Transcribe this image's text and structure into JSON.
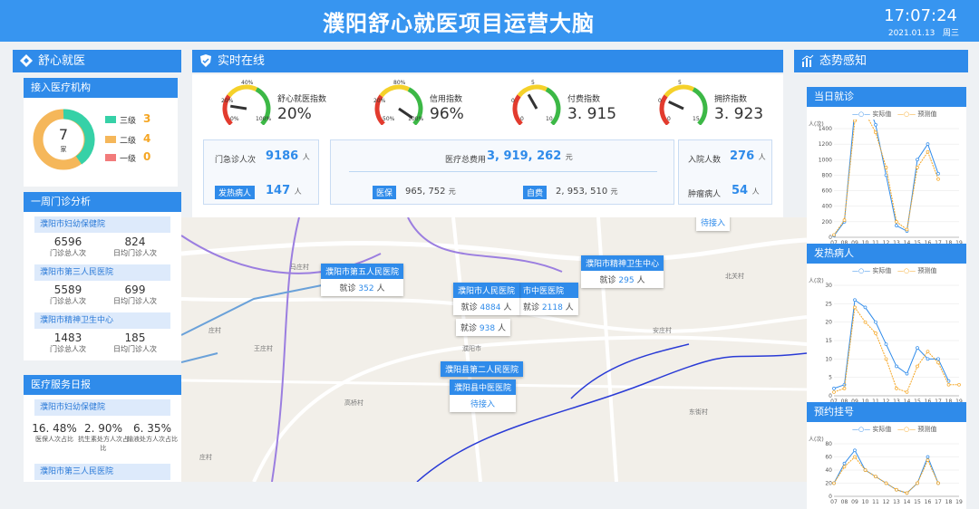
{
  "header": {
    "title": "濮阳舒心就医项目运营大脑",
    "time": "17:07:24",
    "date": "2021.01.13",
    "weekday": "周三"
  },
  "left": {
    "shuxin_title": "舒心就医",
    "institutions_title": "接入医疗机构",
    "donut": {
      "total": "7",
      "unit": "家",
      "levels": [
        {
          "label": "三级",
          "value": "3",
          "color": "#36d1a7"
        },
        {
          "label": "二级",
          "value": "4",
          "color": "#f5b75a"
        },
        {
          "label": "一级",
          "value": "0",
          "color": "#f27b7b"
        }
      ]
    },
    "weekly_title": "一周门诊分析",
    "weekly": [
      {
        "name": "濮阳市妇幼保健院",
        "a": "6596",
        "al": "门诊总人次",
        "b": "824",
        "bl": "日均门诊人次"
      },
      {
        "name": "濮阳市第三人民医院",
        "a": "5589",
        "al": "门诊总人次",
        "b": "699",
        "bl": "日均门诊人次"
      },
      {
        "name": "濮阳市精神卫生中心",
        "a": "1483",
        "al": "门诊总人次",
        "b": "185",
        "bl": "日均门诊人次"
      }
    ],
    "daily_title": "医疗服务日报",
    "daily": {
      "name": "濮阳市妇幼保健院",
      "vals": [
        {
          "v": "16. 48%",
          "l": "医保人次占比"
        },
        {
          "v": "2. 90%",
          "l": "抗生素处方人次占比"
        },
        {
          "v": "6. 35%",
          "l": "输液处方人次占比"
        }
      ],
      "name2": "濮阳市第三人民医院"
    }
  },
  "realtime": {
    "title": "实时在线",
    "gauges": [
      {
        "label": "舒心就医指数",
        "value": "20%",
        "t1": "40%",
        "t2": "20%",
        "t3": "0%",
        "t4": "100%"
      },
      {
        "label": "信用指数",
        "value": "96%",
        "t1": "80%",
        "t2": "20%",
        "t3": "50%",
        "t4": "100%"
      },
      {
        "label": "付费指数",
        "value": "3. 915",
        "t1": "5",
        "t2": "0",
        "t3": "0",
        "t4": "10"
      },
      {
        "label": "拥挤指数",
        "value": "3. 923",
        "t1": "5",
        "t2": "0",
        "t3": "0",
        "t4": "15"
      }
    ],
    "outpatient_label": "门急诊人次",
    "outpatient": "9186",
    "fever_label": "发热病人",
    "fever": "147",
    "total_cost_label": "医疗总费用",
    "total_cost": "3, 919, 262",
    "ins_label": "医保",
    "ins": "965, 752",
    "self_label": "自费",
    "self": "2, 953, 510",
    "admit_label": "入院人数",
    "admit": "276",
    "tumor_label": "肿瘤病人",
    "tumor": "54",
    "unit_person": "人",
    "unit_yuan": "元"
  },
  "map": {
    "popups": [
      {
        "name": "濮阳市第五人民医院",
        "text": "就诊",
        "val": "352",
        "unit": "人"
      },
      {
        "name": "濮阳市精神卫生中心",
        "text": "就诊",
        "val": "295",
        "unit": "人"
      },
      {
        "name": "濮阳市人民医院",
        "text": "就诊",
        "val": "4884",
        "unit": "人"
      },
      {
        "name": "市中医医院",
        "text": "就诊",
        "val": "2118",
        "unit": "人"
      },
      {
        "name": "",
        "text": "就诊",
        "val": "938",
        "unit": "人"
      },
      {
        "name": "濮阳县第二人民医院",
        "text": "",
        "val": "",
        "unit": ""
      },
      {
        "name": "濮阳县中医医院",
        "text": "待接入",
        "val": "",
        "unit": ""
      }
    ],
    "waiting": "待接入",
    "places": [
      "濮阳市",
      "马庄村",
      "庄村",
      "高桥村",
      "王庄村",
      "东街村",
      "安庄村",
      "北关村",
      "庄村"
    ]
  },
  "right": {
    "title": "态势感知",
    "legend_actual": "实际值",
    "legend_pred": "预测值",
    "charts": [
      {
        "title": "当日就诊"
      },
      {
        "title": "发热病人"
      },
      {
        "title": "预约挂号"
      }
    ]
  },
  "chart_data": [
    {
      "type": "line",
      "title": "当日就诊",
      "ylabel": "人(次)",
      "categories": [
        "07",
        "08",
        "09",
        "10",
        "11",
        "12",
        "13",
        "14",
        "15",
        "16",
        "17",
        "18",
        "19"
      ],
      "ylim": [
        0,
        1400
      ],
      "yticks": [
        0,
        200,
        400,
        600,
        800,
        1000,
        1200,
        1400
      ],
      "series": [
        {
          "name": "实际值",
          "values": [
            20,
            200,
            1650,
            1800,
            1450,
            800,
            150,
            80,
            1000,
            1200,
            820,
            null,
            null
          ]
        },
        {
          "name": "预测值",
          "values": [
            30,
            220,
            1500,
            1600,
            1350,
            900,
            200,
            100,
            900,
            1100,
            750,
            null,
            null
          ]
        }
      ]
    },
    {
      "type": "line",
      "title": "发热病人",
      "ylabel": "人(次)",
      "categories": [
        "07",
        "08",
        "09",
        "10",
        "11",
        "12",
        "13",
        "14",
        "15",
        "16",
        "17",
        "18",
        "19"
      ],
      "ylim": [
        0,
        30
      ],
      "yticks": [
        0,
        5,
        10,
        15,
        20,
        25,
        30
      ],
      "series": [
        {
          "name": "实际值",
          "values": [
            2,
            3,
            26,
            24,
            20,
            14,
            8,
            6,
            13,
            10,
            10,
            4,
            null
          ]
        },
        {
          "name": "预测值",
          "values": [
            1,
            2,
            24,
            20,
            17,
            10,
            2,
            1,
            8,
            12,
            9,
            3,
            3
          ]
        }
      ]
    },
    {
      "type": "line",
      "title": "预约挂号",
      "ylabel": "人(次)",
      "categories": [
        "07",
        "08",
        "09",
        "10",
        "11",
        "12",
        "13",
        "14",
        "15",
        "16",
        "17",
        "18",
        "19"
      ],
      "ylim": [
        0,
        80
      ],
      "yticks": [
        0,
        20,
        40,
        60,
        80
      ],
      "series": [
        {
          "name": "实际值",
          "values": [
            20,
            50,
            70,
            40,
            30,
            20,
            10,
            5,
            20,
            60,
            20,
            null,
            null
          ]
        },
        {
          "name": "预测值",
          "values": [
            20,
            45,
            60,
            40,
            30,
            20,
            10,
            5,
            20,
            55,
            20,
            null,
            null
          ]
        }
      ]
    }
  ]
}
